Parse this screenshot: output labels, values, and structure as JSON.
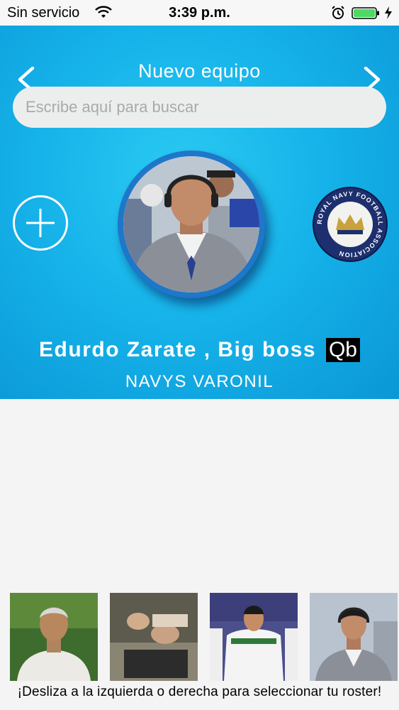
{
  "status_bar": {
    "carrier": "Sin servicio",
    "time": "3:39 p.m.",
    "battery_color": "#4cd964"
  },
  "header": {
    "title": "Nuevo equipo",
    "prev_icon": "chevron-left-icon",
    "next_icon": "chevron-right-icon",
    "background_color": "#16b3ea"
  },
  "search": {
    "placeholder": "Escribe aquí para buscar",
    "value": ""
  },
  "add_button_icon": "plus-circle-icon",
  "profile": {
    "name": "Edurdo Zarate , Big boss",
    "position": "Qb",
    "team": "NAVYS VARONIL"
  },
  "team_logo": {
    "text": "ROYAL NAVY FOOTBALL ASSOCIATION",
    "color": "#1d2f6e"
  },
  "roster": {
    "thumbnails": [
      "roster-photo-1",
      "roster-photo-2",
      "roster-photo-3",
      "roster-photo-4"
    ],
    "hint": "¡Desliza a la izquierda o derecha para seleccionar tu roster!"
  }
}
